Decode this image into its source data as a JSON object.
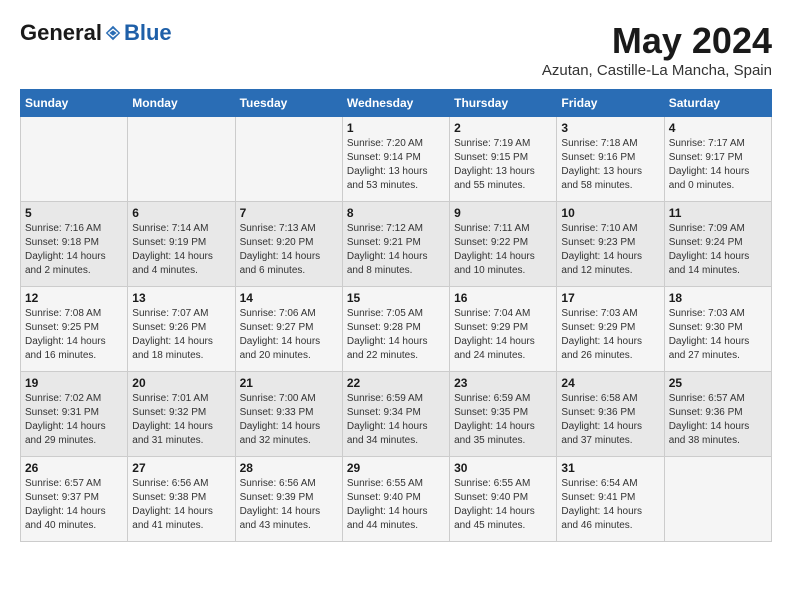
{
  "logo": {
    "general": "General",
    "blue": "Blue"
  },
  "title": "May 2024",
  "location": "Azutan, Castille-La Mancha, Spain",
  "headers": [
    "Sunday",
    "Monday",
    "Tuesday",
    "Wednesday",
    "Thursday",
    "Friday",
    "Saturday"
  ],
  "weeks": [
    [
      {
        "day": "",
        "sunrise": "",
        "sunset": "",
        "daylight": ""
      },
      {
        "day": "",
        "sunrise": "",
        "sunset": "",
        "daylight": ""
      },
      {
        "day": "",
        "sunrise": "",
        "sunset": "",
        "daylight": ""
      },
      {
        "day": "1",
        "sunrise": "Sunrise: 7:20 AM",
        "sunset": "Sunset: 9:14 PM",
        "daylight": "Daylight: 13 hours and 53 minutes."
      },
      {
        "day": "2",
        "sunrise": "Sunrise: 7:19 AM",
        "sunset": "Sunset: 9:15 PM",
        "daylight": "Daylight: 13 hours and 55 minutes."
      },
      {
        "day": "3",
        "sunrise": "Sunrise: 7:18 AM",
        "sunset": "Sunset: 9:16 PM",
        "daylight": "Daylight: 13 hours and 58 minutes."
      },
      {
        "day": "4",
        "sunrise": "Sunrise: 7:17 AM",
        "sunset": "Sunset: 9:17 PM",
        "daylight": "Daylight: 14 hours and 0 minutes."
      }
    ],
    [
      {
        "day": "5",
        "sunrise": "Sunrise: 7:16 AM",
        "sunset": "Sunset: 9:18 PM",
        "daylight": "Daylight: 14 hours and 2 minutes."
      },
      {
        "day": "6",
        "sunrise": "Sunrise: 7:14 AM",
        "sunset": "Sunset: 9:19 PM",
        "daylight": "Daylight: 14 hours and 4 minutes."
      },
      {
        "day": "7",
        "sunrise": "Sunrise: 7:13 AM",
        "sunset": "Sunset: 9:20 PM",
        "daylight": "Daylight: 14 hours and 6 minutes."
      },
      {
        "day": "8",
        "sunrise": "Sunrise: 7:12 AM",
        "sunset": "Sunset: 9:21 PM",
        "daylight": "Daylight: 14 hours and 8 minutes."
      },
      {
        "day": "9",
        "sunrise": "Sunrise: 7:11 AM",
        "sunset": "Sunset: 9:22 PM",
        "daylight": "Daylight: 14 hours and 10 minutes."
      },
      {
        "day": "10",
        "sunrise": "Sunrise: 7:10 AM",
        "sunset": "Sunset: 9:23 PM",
        "daylight": "Daylight: 14 hours and 12 minutes."
      },
      {
        "day": "11",
        "sunrise": "Sunrise: 7:09 AM",
        "sunset": "Sunset: 9:24 PM",
        "daylight": "Daylight: 14 hours and 14 minutes."
      }
    ],
    [
      {
        "day": "12",
        "sunrise": "Sunrise: 7:08 AM",
        "sunset": "Sunset: 9:25 PM",
        "daylight": "Daylight: 14 hours and 16 minutes."
      },
      {
        "day": "13",
        "sunrise": "Sunrise: 7:07 AM",
        "sunset": "Sunset: 9:26 PM",
        "daylight": "Daylight: 14 hours and 18 minutes."
      },
      {
        "day": "14",
        "sunrise": "Sunrise: 7:06 AM",
        "sunset": "Sunset: 9:27 PM",
        "daylight": "Daylight: 14 hours and 20 minutes."
      },
      {
        "day": "15",
        "sunrise": "Sunrise: 7:05 AM",
        "sunset": "Sunset: 9:28 PM",
        "daylight": "Daylight: 14 hours and 22 minutes."
      },
      {
        "day": "16",
        "sunrise": "Sunrise: 7:04 AM",
        "sunset": "Sunset: 9:29 PM",
        "daylight": "Daylight: 14 hours and 24 minutes."
      },
      {
        "day": "17",
        "sunrise": "Sunrise: 7:03 AM",
        "sunset": "Sunset: 9:29 PM",
        "daylight": "Daylight: 14 hours and 26 minutes."
      },
      {
        "day": "18",
        "sunrise": "Sunrise: 7:03 AM",
        "sunset": "Sunset: 9:30 PM",
        "daylight": "Daylight: 14 hours and 27 minutes."
      }
    ],
    [
      {
        "day": "19",
        "sunrise": "Sunrise: 7:02 AM",
        "sunset": "Sunset: 9:31 PM",
        "daylight": "Daylight: 14 hours and 29 minutes."
      },
      {
        "day": "20",
        "sunrise": "Sunrise: 7:01 AM",
        "sunset": "Sunset: 9:32 PM",
        "daylight": "Daylight: 14 hours and 31 minutes."
      },
      {
        "day": "21",
        "sunrise": "Sunrise: 7:00 AM",
        "sunset": "Sunset: 9:33 PM",
        "daylight": "Daylight: 14 hours and 32 minutes."
      },
      {
        "day": "22",
        "sunrise": "Sunrise: 6:59 AM",
        "sunset": "Sunset: 9:34 PM",
        "daylight": "Daylight: 14 hours and 34 minutes."
      },
      {
        "day": "23",
        "sunrise": "Sunrise: 6:59 AM",
        "sunset": "Sunset: 9:35 PM",
        "daylight": "Daylight: 14 hours and 35 minutes."
      },
      {
        "day": "24",
        "sunrise": "Sunrise: 6:58 AM",
        "sunset": "Sunset: 9:36 PM",
        "daylight": "Daylight: 14 hours and 37 minutes."
      },
      {
        "day": "25",
        "sunrise": "Sunrise: 6:57 AM",
        "sunset": "Sunset: 9:36 PM",
        "daylight": "Daylight: 14 hours and 38 minutes."
      }
    ],
    [
      {
        "day": "26",
        "sunrise": "Sunrise: 6:57 AM",
        "sunset": "Sunset: 9:37 PM",
        "daylight": "Daylight: 14 hours and 40 minutes."
      },
      {
        "day": "27",
        "sunrise": "Sunrise: 6:56 AM",
        "sunset": "Sunset: 9:38 PM",
        "daylight": "Daylight: 14 hours and 41 minutes."
      },
      {
        "day": "28",
        "sunrise": "Sunrise: 6:56 AM",
        "sunset": "Sunset: 9:39 PM",
        "daylight": "Daylight: 14 hours and 43 minutes."
      },
      {
        "day": "29",
        "sunrise": "Sunrise: 6:55 AM",
        "sunset": "Sunset: 9:40 PM",
        "daylight": "Daylight: 14 hours and 44 minutes."
      },
      {
        "day": "30",
        "sunrise": "Sunrise: 6:55 AM",
        "sunset": "Sunset: 9:40 PM",
        "daylight": "Daylight: 14 hours and 45 minutes."
      },
      {
        "day": "31",
        "sunrise": "Sunrise: 6:54 AM",
        "sunset": "Sunset: 9:41 PM",
        "daylight": "Daylight: 14 hours and 46 minutes."
      },
      {
        "day": "",
        "sunrise": "",
        "sunset": "",
        "daylight": ""
      }
    ]
  ]
}
